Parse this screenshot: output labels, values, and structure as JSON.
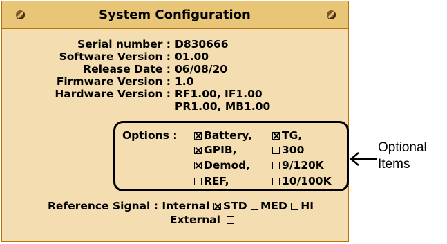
{
  "title": "System Configuration",
  "info": [
    {
      "label": "Serial number :",
      "value": "D830666"
    },
    {
      "label": "Software Version :",
      "value": "01.00"
    },
    {
      "label": "Release Date :",
      "value": "06/08/20"
    },
    {
      "label": "Firmware Version :",
      "value": "1.0"
    },
    {
      "label": "Hardware Version :",
      "value": "RF1.00, IF1.00",
      "value2": "PR1.00, MB1.00"
    }
  ],
  "options": {
    "label": "Options :",
    "items": [
      {
        "label": "Battery,",
        "checked": true
      },
      {
        "label": "TG,",
        "checked": true
      },
      {
        "label": "GPIB,",
        "checked": true
      },
      {
        "label": "300",
        "checked": false
      },
      {
        "label": "Demod,",
        "checked": true
      },
      {
        "label": "9/120K",
        "checked": false
      },
      {
        "label": "REF,",
        "checked": false
      },
      {
        "label": "10/100K",
        "checked": false
      }
    ]
  },
  "reference": {
    "label": "Reference Signal :",
    "internal_label": "Internal",
    "std": {
      "label": "STD",
      "checked": true
    },
    "med": {
      "label": "MED",
      "checked": false
    },
    "hi": {
      "label": "HI",
      "checked": false
    },
    "external_label": "External",
    "external_checked": false
  },
  "annotation": {
    "line1": "Optional",
    "line2": "Items"
  }
}
